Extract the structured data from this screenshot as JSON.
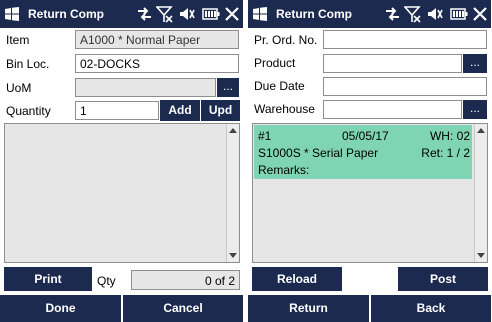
{
  "left": {
    "title": "Return Comp",
    "item_label": "Item",
    "item_value": "A1000 * Normal Paper",
    "binloc_label": "Bin Loc.",
    "binloc_value": "02-DOCKS",
    "uom_label": "UoM",
    "uom_value": "",
    "uom_button": "...",
    "quantity_label": "Quantity",
    "quantity_value": "1",
    "add_label": "Add",
    "upd_label": "Upd",
    "print_label": "Print",
    "qty_label": "Qty",
    "qty_value": "0 of 2",
    "done_label": "Done",
    "cancel_label": "Cancel"
  },
  "right": {
    "title": "Return Comp",
    "pr_ord_label": "Pr. Ord. No.",
    "pr_ord_value": "",
    "product_label": "Product",
    "product_value": "",
    "product_button": "...",
    "due_date_label": "Due Date",
    "due_date_value": "",
    "warehouse_label": "Warehouse",
    "warehouse_value": "",
    "warehouse_button": "...",
    "item": {
      "number": "#1",
      "date": "05/05/17",
      "wh": "WH: 02",
      "product": "S1000S * Serial Paper",
      "ret": "Ret: 1 / 2",
      "remarks": "Remarks:"
    },
    "reload_label": "Reload",
    "post_label": "Post",
    "return_label": "Return",
    "back_label": "Back"
  },
  "colors": {
    "bar": "#1b2a4e",
    "selected_item": "#7fd4b3",
    "readonly": "#e6e6e6"
  },
  "icons": [
    "windows-icon",
    "connectivity-icon",
    "signal-icon",
    "volume-icon",
    "battery-icon",
    "close-icon"
  ]
}
